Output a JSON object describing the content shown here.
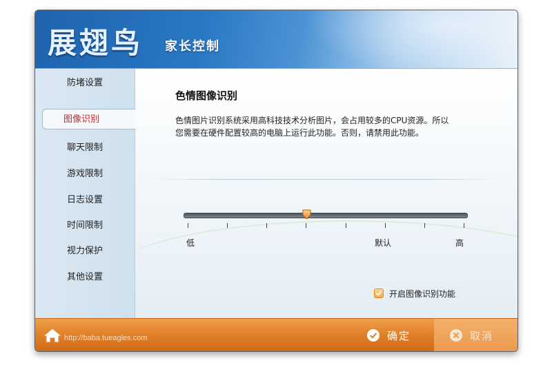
{
  "header": {
    "brand": "展翅鸟",
    "subtitle": "家长控制"
  },
  "sidebar": {
    "items": [
      {
        "label": "防堵设置",
        "active": false
      },
      {
        "label": "图像识别",
        "active": true
      },
      {
        "label": "聊天限制",
        "active": false
      },
      {
        "label": "游戏限制",
        "active": false
      },
      {
        "label": "日志设置",
        "active": false
      },
      {
        "label": "时间限制",
        "active": false
      },
      {
        "label": "视力保护",
        "active": false
      },
      {
        "label": "其他设置",
        "active": false
      }
    ]
  },
  "content": {
    "title": "色情图像识别",
    "description_line1": "色情图片识别系统采用高科技技术分析图片，会占用较多的CPU资源。所以",
    "description_line2": "您需要在硬件配置较高的电脑上运行此功能。否则，请禁用此功能。",
    "slider": {
      "label_low": "低",
      "label_default": "默认",
      "label_high": "高",
      "tick_count": 8,
      "value_fraction": 0.43
    },
    "checkbox": {
      "label": "开启图像识别功能",
      "checked": true
    }
  },
  "footer": {
    "url": "http://baba.tueagles.com",
    "ok_label": "确定",
    "cancel_label": "取消"
  },
  "icons": {
    "home": "home-icon",
    "ok": "check-circle-icon",
    "cancel": "x-circle-icon",
    "checkbox": "checkmark-icon"
  },
  "colors": {
    "accent_blue": "#2a78c4",
    "footer_orange": "#e2822a",
    "active_text": "#c2282a"
  }
}
